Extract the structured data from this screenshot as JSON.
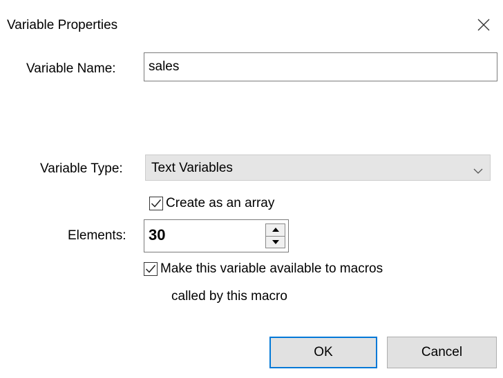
{
  "dialog": {
    "title": "Variable Properties"
  },
  "name": {
    "label": "Variable Name:",
    "value": "sales"
  },
  "type": {
    "label": "Variable Type:",
    "selected": "Text Variables"
  },
  "array": {
    "label": "Create as an array",
    "checked": true
  },
  "elements": {
    "label": "Elements:",
    "value": "30"
  },
  "available": {
    "label_line1": "Make this variable available to macros",
    "label_line2": "called by this macro",
    "checked": true
  },
  "buttons": {
    "ok": "OK",
    "cancel": "Cancel"
  },
  "colors": {
    "accent": "#0078d7",
    "select_bg": "#e5e5e5",
    "button_bg": "#e1e1e1"
  }
}
